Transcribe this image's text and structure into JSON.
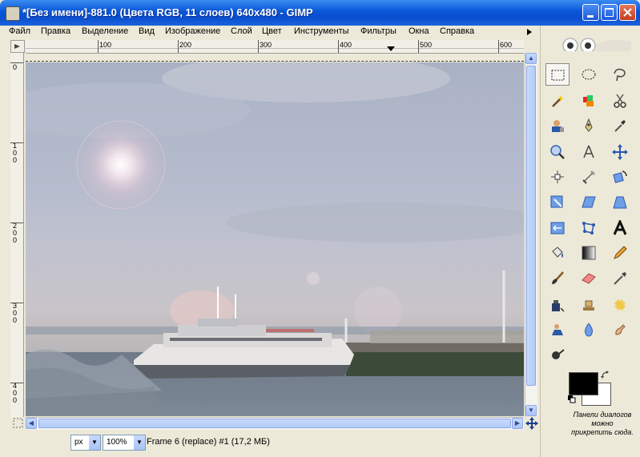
{
  "window": {
    "title": "*[Без имени]-881.0 (Цвета RGB, 11 слоев) 640x480 - GIMP"
  },
  "menu": [
    {
      "label": "Файл"
    },
    {
      "label": "Правка"
    },
    {
      "label": "Выделение"
    },
    {
      "label": "Вид"
    },
    {
      "label": "Изображение"
    },
    {
      "label": "Слой"
    },
    {
      "label": "Цвет"
    },
    {
      "label": "Инструменты"
    },
    {
      "label": "Фильтры"
    },
    {
      "label": "Окна"
    },
    {
      "label": "Справка"
    }
  ],
  "ruler": {
    "h_labels": [
      "100",
      "200",
      "300",
      "400",
      "500",
      "600"
    ],
    "v_labels": [
      "0",
      "100",
      "200",
      "300",
      "400"
    ]
  },
  "status": {
    "unit": "px",
    "zoom": "100%",
    "text": "Frame 6 (replace) #1 (17,2 МБ)"
  },
  "toolbox": {
    "dock_note": "Панели диалогов можно прикрепить сюда.",
    "fg_color": "#000000",
    "bg_color": "#ffffff",
    "tools": [
      "rect-select-icon",
      "ellipse-select-icon",
      "lasso-icon",
      "fuzzy-select-icon",
      "select-by-color-icon",
      "scissors-icon",
      "foreground-select-icon",
      "paths-icon",
      "color-picker-icon",
      "zoom-icon",
      "measure-icon",
      "move-icon",
      "align-icon",
      "crop-icon",
      "rotate-icon",
      "scale-icon",
      "shear-icon",
      "perspective-icon",
      "flip-icon",
      "cage-transform-icon",
      "text-icon",
      "bucket-fill-icon",
      "blend-icon",
      "pencil-icon",
      "paintbrush-icon",
      "eraser-icon",
      "airbrush-icon",
      "ink-icon",
      "clone-icon",
      "heal-icon",
      "perspective-clone-icon",
      "blur-icon",
      "smudge-icon",
      "dodge-burn-icon"
    ]
  }
}
